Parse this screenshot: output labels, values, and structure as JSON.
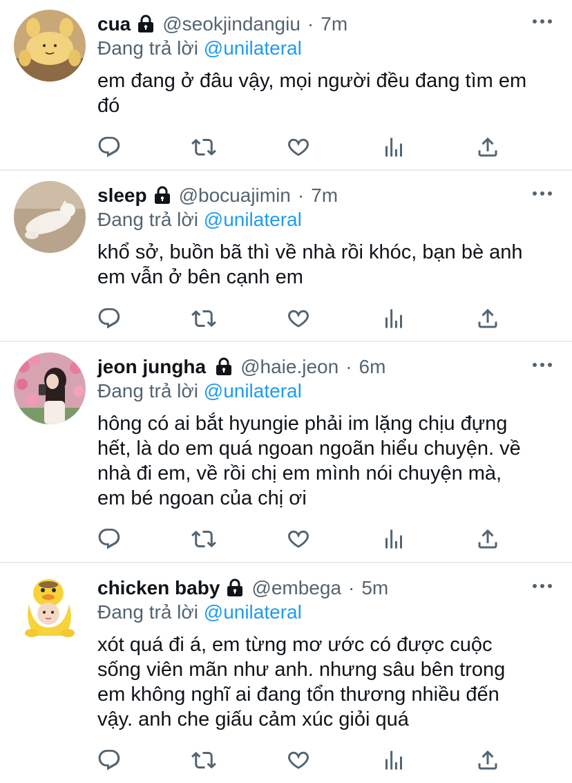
{
  "colors": {
    "text": "#0f1419",
    "secondary": "#536471",
    "link": "#1d9bf0",
    "divider": "#e6ecf0"
  },
  "icons": {
    "lock": "lock-icon",
    "more": "more-icon",
    "reply": "reply-icon",
    "retweet": "retweet-icon",
    "like": "like-icon",
    "views": "views-icon",
    "share": "share-icon"
  },
  "tweets": [
    {
      "name": "cua",
      "handle": "@seokjindangiu",
      "dot": "·",
      "time": "7m",
      "reply_prefix": "Đang trả lời",
      "reply_mention": "@unilateral",
      "lines": [
        "em đang ở đâu vậy, mọi người đều đang tìm em",
        "đó"
      ]
    },
    {
      "name": "sleep",
      "handle": "@bocuajimin",
      "dot": "·",
      "time": "7m",
      "reply_prefix": "Đang trả lời",
      "reply_mention": "@unilateral",
      "lines": [
        "khổ sở, buồn bã thì về nhà rồi khóc, bạn bè anh",
        "em vẫn ở bên cạnh em"
      ]
    },
    {
      "name": "jeon jungha",
      "handle": "@haie.jeon",
      "dot": "·",
      "time": "6m",
      "reply_prefix": "Đang trả lời",
      "reply_mention": "@unilateral",
      "lines": [
        "hông có ai bắt hyungie phải im lặng chịu đựng",
        "hết, là do em quá ngoan ngoãn hiểu chuyện. về",
        "nhà đi em, về rồi chị em mình nói chuyện mà,",
        "em bé ngoan của chị ơi"
      ]
    },
    {
      "name": "chicken baby",
      "handle": "@embega",
      "dot": "·",
      "time": "5m",
      "reply_prefix": "Đang trả lời",
      "reply_mention": "@unilateral",
      "lines": [
        "xót quá đi á, em từng mơ ước có được cuộc",
        "sống viên mãn như anh. nhưng sâu bên trong",
        "em không nghĩ ai đang tổn thương nhiều đến",
        "vậy. anh che giấu cảm xúc giỏi quá"
      ]
    }
  ]
}
